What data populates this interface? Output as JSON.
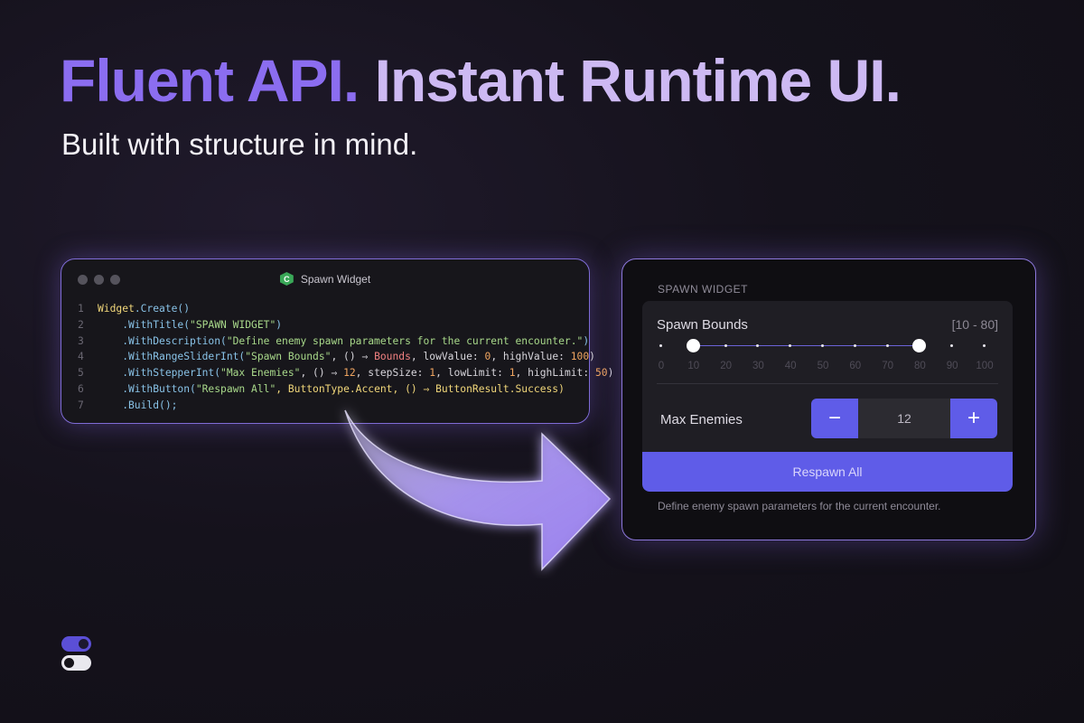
{
  "headline": {
    "part1": "Fluent API.",
    "part2": "Instant Runtime UI."
  },
  "subheadline": "Built with structure in mind.",
  "code_window": {
    "title": "Spawn Widget",
    "file_icon": "csharp-icon",
    "lines": [
      {
        "n": "1",
        "tokens": [
          {
            "t": "Widget",
            "c": "cls"
          },
          {
            "t": ".Create()",
            "c": "m"
          }
        ]
      },
      {
        "n": "2",
        "tokens": [
          {
            "t": "    .WithTitle(",
            "c": "m"
          },
          {
            "t": "\"SPAWN WIDGET\"",
            "c": "s"
          },
          {
            "t": ")",
            "c": "m"
          }
        ]
      },
      {
        "n": "3",
        "tokens": [
          {
            "t": "    .WithDescription(",
            "c": "m"
          },
          {
            "t": "\"Define enemy spawn parameters for the current encounter.\"",
            "c": "s"
          },
          {
            "t": ")",
            "c": "m"
          }
        ]
      },
      {
        "n": "4",
        "tokens": [
          {
            "t": "    .WithRangeSliderInt(",
            "c": "m"
          },
          {
            "t": "\"Spawn Bounds\"",
            "c": "s"
          },
          {
            "t": ", () ⇒ ",
            "c": "d"
          },
          {
            "t": "Bounds",
            "c": "p"
          },
          {
            "t": ", lowValue: ",
            "c": "d"
          },
          {
            "t": "0",
            "c": "n"
          },
          {
            "t": ", highValue: ",
            "c": "d"
          },
          {
            "t": "100",
            "c": "n"
          },
          {
            "t": ")",
            "c": "d"
          }
        ]
      },
      {
        "n": "5",
        "tokens": [
          {
            "t": "    .WithStepperInt(",
            "c": "m"
          },
          {
            "t": "\"Max Enemies\"",
            "c": "s"
          },
          {
            "t": ", () ⇒ ",
            "c": "d"
          },
          {
            "t": "12",
            "c": "n"
          },
          {
            "t": ", stepSize: ",
            "c": "d"
          },
          {
            "t": "1",
            "c": "n"
          },
          {
            "t": ", lowLimit: ",
            "c": "d"
          },
          {
            "t": "1",
            "c": "n"
          },
          {
            "t": ", highLimit: ",
            "c": "d"
          },
          {
            "t": "50",
            "c": "n"
          },
          {
            "t": ")",
            "c": "d"
          }
        ]
      },
      {
        "n": "6",
        "tokens": [
          {
            "t": "    .WithButton(",
            "c": "m"
          },
          {
            "t": "\"Respawn All\"",
            "c": "s"
          },
          {
            "t": ", ButtonType.Accent, () ⇒ ButtonResult.Success)",
            "c": "cls"
          }
        ]
      },
      {
        "n": "7",
        "tokens": [
          {
            "t": "    .Build();",
            "c": "m"
          }
        ]
      }
    ]
  },
  "widget": {
    "title": "SPAWN WIDGET",
    "range": {
      "label": "Spawn Bounds",
      "value_text": "[10 - 80]",
      "min": 0,
      "max": 100,
      "low": 10,
      "high": 80,
      "ticks": [
        "0",
        "10",
        "20",
        "30",
        "40",
        "50",
        "60",
        "70",
        "80",
        "90",
        "100"
      ]
    },
    "stepper": {
      "label": "Max Enemies",
      "value": "12",
      "decrement_symbol": "−",
      "increment_symbol": "+"
    },
    "button_label": "Respawn All",
    "description": "Define enemy spawn parameters for the current encounter."
  },
  "colors": {
    "accent": "#5f5ce8",
    "headline_primary": "#8b6df0",
    "headline_secondary": "#cdb9f3",
    "glow_border": "#8d78dc"
  }
}
